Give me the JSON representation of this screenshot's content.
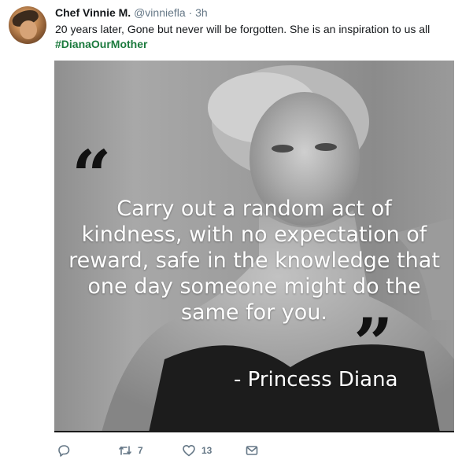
{
  "tweet": {
    "author_name": "Chef Vinnie M.",
    "handle": "@vinniefla",
    "separator": "·",
    "time": "3h",
    "text": "20 years later, Gone but never will be forgotten. She is an inspiration to us all",
    "hashtag": "#DianaOurMother"
  },
  "media": {
    "quote_open": "“",
    "quote_lines": [
      "Carry out a random act of",
      "kindness, with no expectation of",
      "reward, safe in the knowledge that",
      "one day someone might do the",
      "same for you."
    ],
    "quote_close": "”",
    "attribution": "- Princess Diana"
  },
  "actions": {
    "reply": {
      "icon": "reply-icon",
      "count": ""
    },
    "retweet": {
      "icon": "retweet-icon",
      "count": "7"
    },
    "like": {
      "icon": "heart-icon",
      "count": "13"
    },
    "dm": {
      "icon": "envelope-icon",
      "count": ""
    }
  },
  "colors": {
    "hashtag": "#1b7a3d",
    "muted": "#657786",
    "text": "#14171a"
  }
}
